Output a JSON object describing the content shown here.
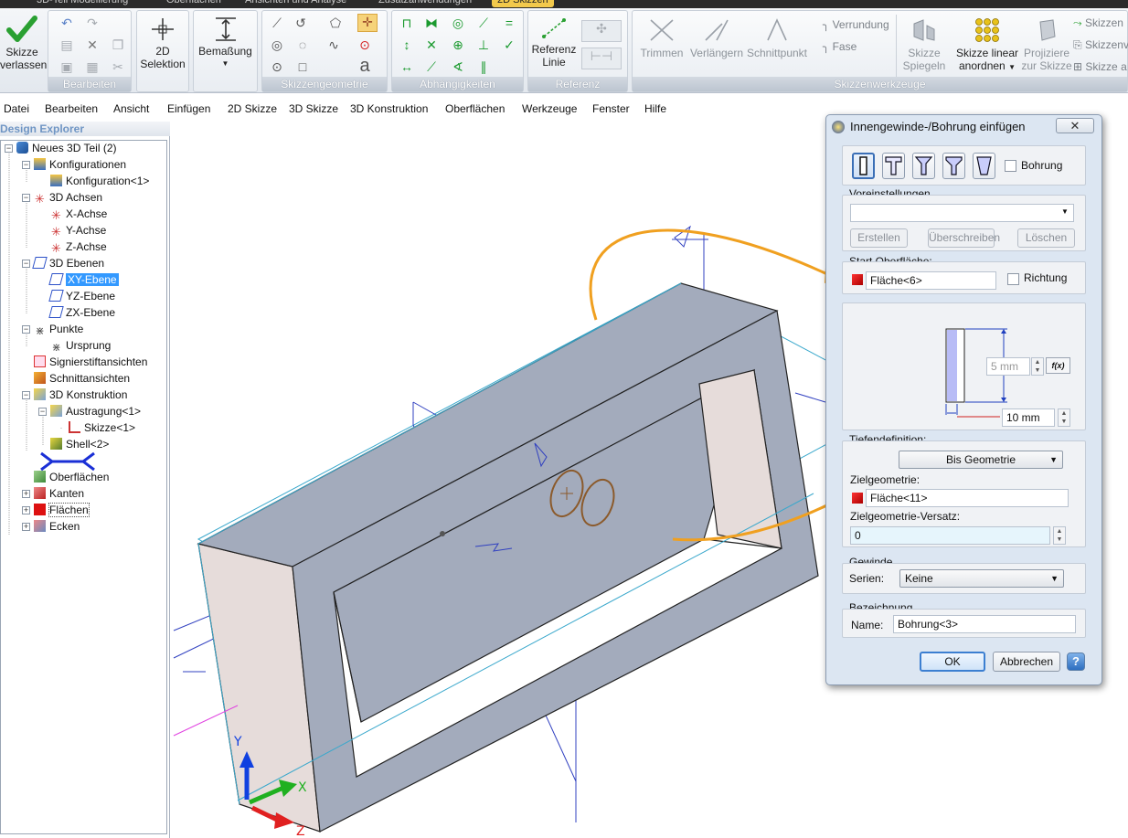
{
  "ribbon": {
    "tabs": [
      "3D-Teil Modellierung",
      "Oberflächen",
      "Ansichten und Analyse",
      "Zusatzanwendungen",
      "2D Skizzen"
    ],
    "active_tab_index": 4,
    "exit_sketch": {
      "line1": "Skizze",
      "line2": "verlassen"
    },
    "select_2d": {
      "line1": "2D",
      "line2": "Selektion"
    },
    "dimension": {
      "label": "Bemaßung"
    },
    "reference_line": {
      "line1": "Referenz",
      "line2": "Linie"
    },
    "trim": "Trimmen",
    "extend": "Verlängern",
    "intersect": "Schnittpunkt",
    "fillet": "Verrundung",
    "chamfer": "Fase",
    "mirror": {
      "line1": "Skizze",
      "line2": "Spiegeln"
    },
    "linear_pattern": {
      "line1": "Skizze linear",
      "line2": "anordnen"
    },
    "project": {
      "line1": "Projiziere",
      "line2": "zur Skizze"
    },
    "side_items": [
      "Skizzen",
      "Skizzenv",
      "Skizze a"
    ],
    "groups": {
      "edit": "Bearbeiten",
      "geometry": "Skizzengeometrie",
      "constraints": "Abhängigkeiten",
      "reference": "Referenz",
      "tools": "Skizzenwerkzeuge"
    }
  },
  "menu": [
    "Datei",
    "Bearbeiten",
    "Ansicht",
    "Einfügen",
    "2D Skizze",
    "3D Skizze",
    "3D Konstruktion",
    "Oberflächen",
    "Werkzeuge",
    "Fenster",
    "Hilfe"
  ],
  "explorer": {
    "title": "Design Explorer",
    "tree": [
      {
        "label": "Neues 3D Teil (2)",
        "icon": "part-icon"
      },
      {
        "label": "Konfigurationen",
        "icon": "config-icon"
      },
      {
        "label": "Konfiguration<1>",
        "icon": "config-icon"
      },
      {
        "label": "3D Achsen",
        "icon": "axes-icon"
      },
      {
        "label": "X-Achse",
        "icon": "axes-icon"
      },
      {
        "label": "Y-Achse",
        "icon": "axes-icon"
      },
      {
        "label": "Z-Achse",
        "icon": "axes-icon"
      },
      {
        "label": "3D Ebenen",
        "icon": "plane-icon"
      },
      {
        "label": "XY-Ebene",
        "icon": "plane-icon"
      },
      {
        "label": "YZ-Ebene",
        "icon": "plane-icon"
      },
      {
        "label": "ZX-Ebene",
        "icon": "plane-icon"
      },
      {
        "label": "Punkte",
        "icon": "point-icon"
      },
      {
        "label": "Ursprung",
        "icon": "point-icon"
      },
      {
        "label": "Signierstiftansichten",
        "icon": "pen-icon"
      },
      {
        "label": "Schnittansichten",
        "icon": "section-icon"
      },
      {
        "label": "3D Konstruktion",
        "icon": "construction-icon"
      },
      {
        "label": "Austragung<1>",
        "icon": "extrude-icon"
      },
      {
        "label": "Skizze<1>",
        "icon": "sketch-icon"
      },
      {
        "label": "Shell<2>",
        "icon": "shell-icon"
      },
      {
        "label": "Oberflächen",
        "icon": "surface-icon"
      },
      {
        "label": "Kanten",
        "icon": "edge-icon"
      },
      {
        "label": "Flächen",
        "icon": "face-icon"
      },
      {
        "label": "Ecken",
        "icon": "vertex-icon"
      }
    ],
    "selected": "XY-Ebene"
  },
  "dialog": {
    "title": "Innengewinde-/Bohrung einfügen",
    "close_label": "✕",
    "hole_checkbox_label": "Bohrung",
    "presets": {
      "label": "Voreinstellungen",
      "value": "",
      "create": "Erstellen",
      "overwrite": "Überschreiben",
      "delete": "Löschen"
    },
    "start_surface": {
      "label": "Start Oberfläche:",
      "value": "Fläche<6>",
      "direction_label": "Richtung"
    },
    "diagram": {
      "diameter": "5 mm",
      "fx": "f(x)",
      "offset": "10 mm"
    },
    "depth": {
      "label": "Tiefendefinition:",
      "mode": "Bis Geometrie",
      "target_label": "Zielgeometrie:",
      "target_value": "Fläche<11>",
      "offset_label": "Zielgeometrie-Versatz:",
      "offset_value": "0"
    },
    "thread": {
      "label": "Gewinde",
      "series_label": "Serien:",
      "series_value": "Keine"
    },
    "designation": {
      "label": "Bezeichnung",
      "name_label": "Name:",
      "name_value": "Bohrung<3>"
    },
    "ok": "OK",
    "cancel": "Abbrechen",
    "help": "?"
  },
  "colors": {
    "accent": "#3399ff",
    "solid_face_dark": "#a3abbc",
    "solid_face_light": "#e6dcda",
    "sketch_blue": "#3040c0",
    "ref_cyan": "#3aa8cc",
    "orange_arrow": "#f0a020",
    "circle_brown": "#8b5a2b"
  }
}
